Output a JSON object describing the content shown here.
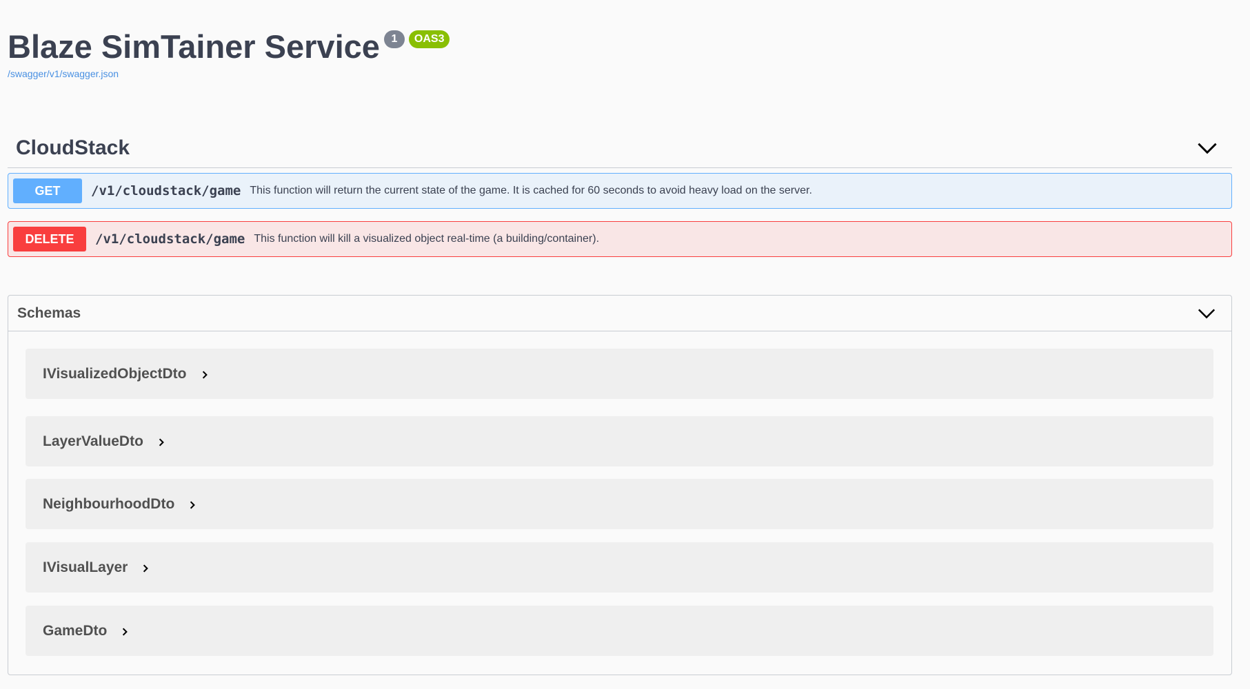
{
  "info": {
    "title": "Blaze SimTainer Service",
    "version_badge": "1",
    "oas_badge": "OAS3",
    "spec_url": "/swagger/v1/swagger.json"
  },
  "tag": {
    "name": "CloudStack",
    "operations": [
      {
        "method": "GET",
        "path": "/v1/cloudstack/game",
        "summary": "This function will return the current state of the game. It is cached for 60 seconds to avoid heavy load on the server."
      },
      {
        "method": "DELETE",
        "path": "/v1/cloudstack/game",
        "summary": "This function will kill a visualized object real-time (a building/container)."
      }
    ]
  },
  "schemas": {
    "title": "Schemas",
    "items": [
      {
        "name": "IVisualizedObjectDto"
      },
      {
        "name": "LayerValueDto"
      },
      {
        "name": "NeighbourhoodDto"
      },
      {
        "name": "IVisualLayer"
      },
      {
        "name": "GameDto"
      }
    ]
  },
  "colors": {
    "get": "#61affe",
    "delete": "#f93e3e",
    "oas_badge": "#89bf04",
    "version_badge": "#7d8492",
    "link": "#4990e2"
  },
  "icons": {
    "section_toggle": "chevron-down-icon",
    "model_toggle": "chevron-right-icon"
  }
}
